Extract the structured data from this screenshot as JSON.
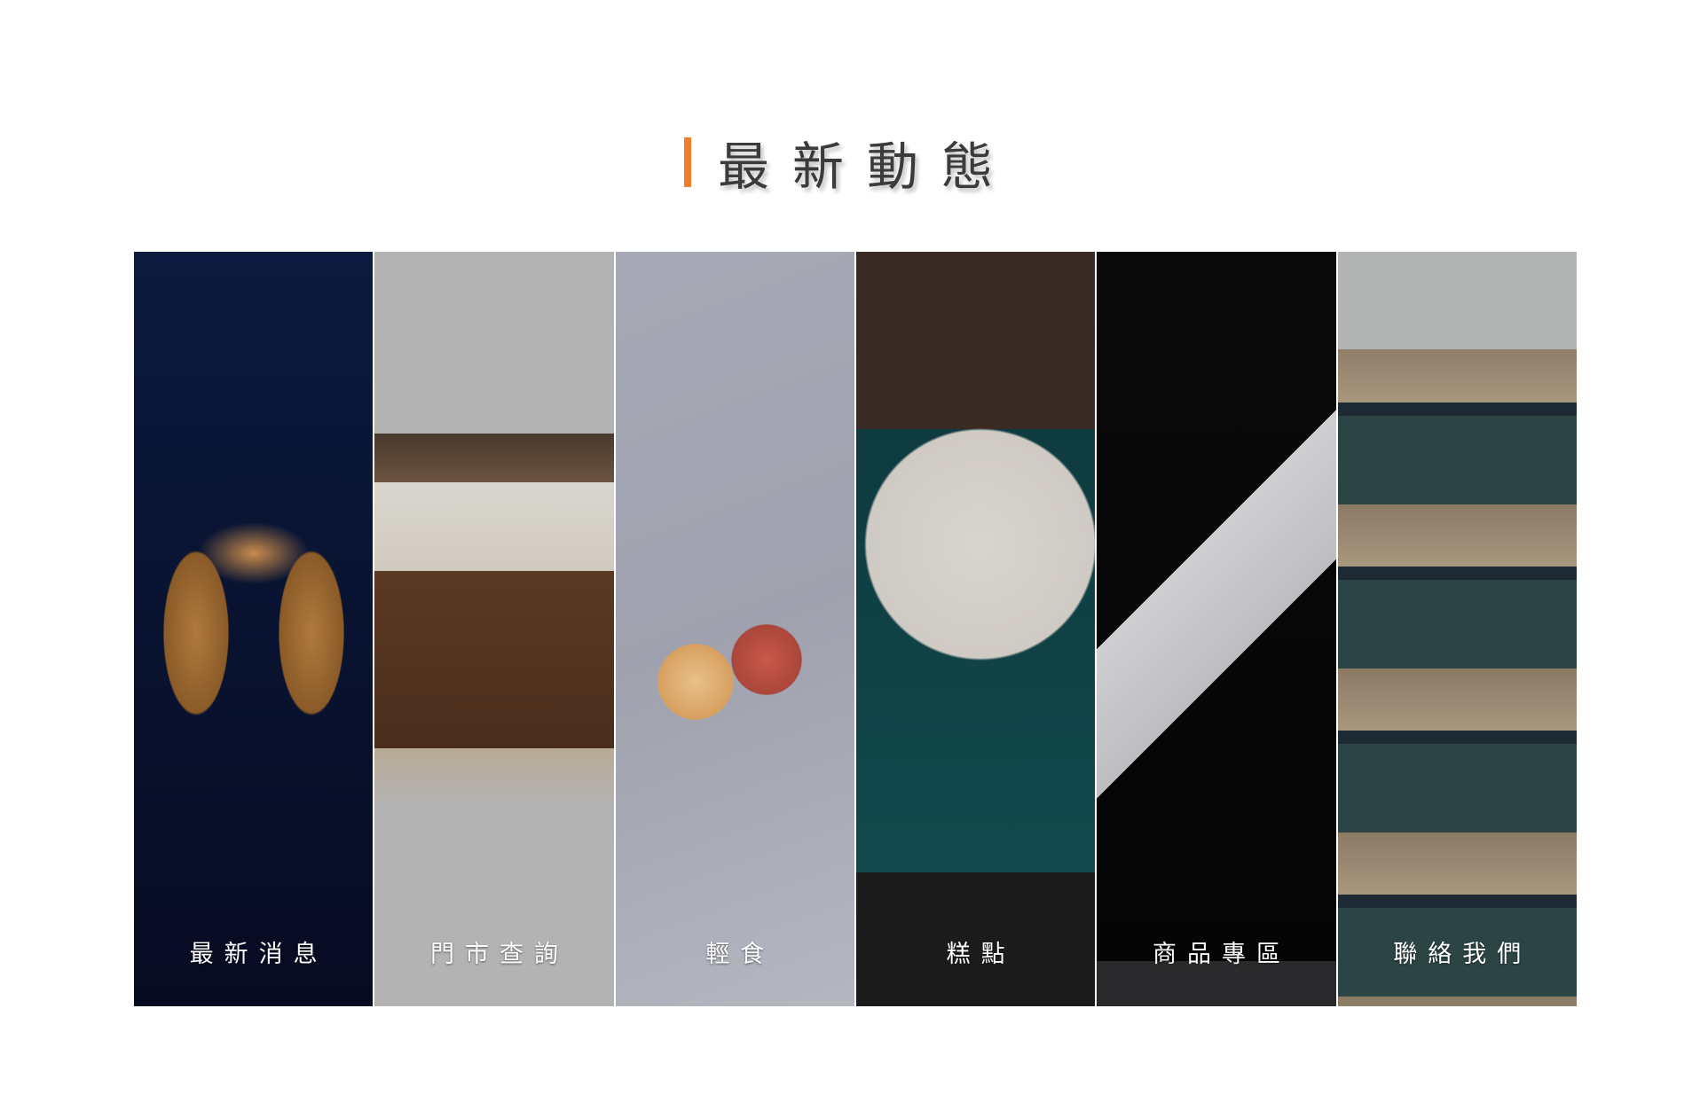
{
  "section": {
    "title": "最新動態",
    "accent_color": "#f07f2c"
  },
  "panels": [
    {
      "label": "最新消息",
      "image": "iced-coffee-toast"
    },
    {
      "label": "門市查詢",
      "image": "cafe-interior"
    },
    {
      "label": "輕食",
      "image": "bagels-on-board"
    },
    {
      "label": "糕點",
      "image": "cakes-plate"
    },
    {
      "label": "商品專區",
      "image": "drip-coffee-boxes"
    },
    {
      "label": "聯絡我們",
      "image": "coffee-bean-jars"
    }
  ]
}
